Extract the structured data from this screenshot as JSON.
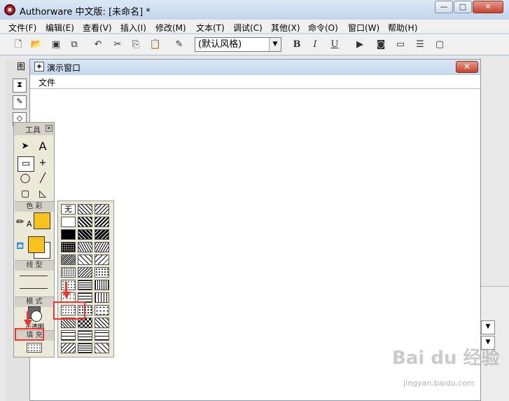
{
  "window": {
    "title": "Authorware 中文版: [未命名] *",
    "min": "—",
    "max": "□",
    "close": "✕"
  },
  "menubar": [
    "文件(F)",
    "编辑(E)",
    "查看(V)",
    "插入(I)",
    "修改(M)",
    "文本(T)",
    "调试(C)",
    "其他(X)",
    "命令(O)",
    "窗口(W)",
    "帮助(H)"
  ],
  "toolbar": {
    "style_select": "(默认风格)",
    "bold": "B",
    "italic": "I",
    "underline": "U"
  },
  "icon_palette": {
    "title": "图"
  },
  "presentation_window": {
    "title": "演示窗口",
    "menu_file": "文件",
    "close": "✕"
  },
  "tools_palette": {
    "title": "工具",
    "close": "☒",
    "section_color": "色 彩",
    "section_line": "线 型",
    "section_mode": "模 式",
    "mode_value": "不透明",
    "section_fill": "填 充",
    "text_tool": "A"
  },
  "fill_patterns": {
    "none_label": "无"
  },
  "watermark": {
    "brand": "Bai du 经验",
    "sub": "jingyan.baidu.com"
  },
  "colors": {
    "accent_red": "#e33",
    "stroke_color": "#f8c21a",
    "fill_color": "#f8c21a"
  }
}
